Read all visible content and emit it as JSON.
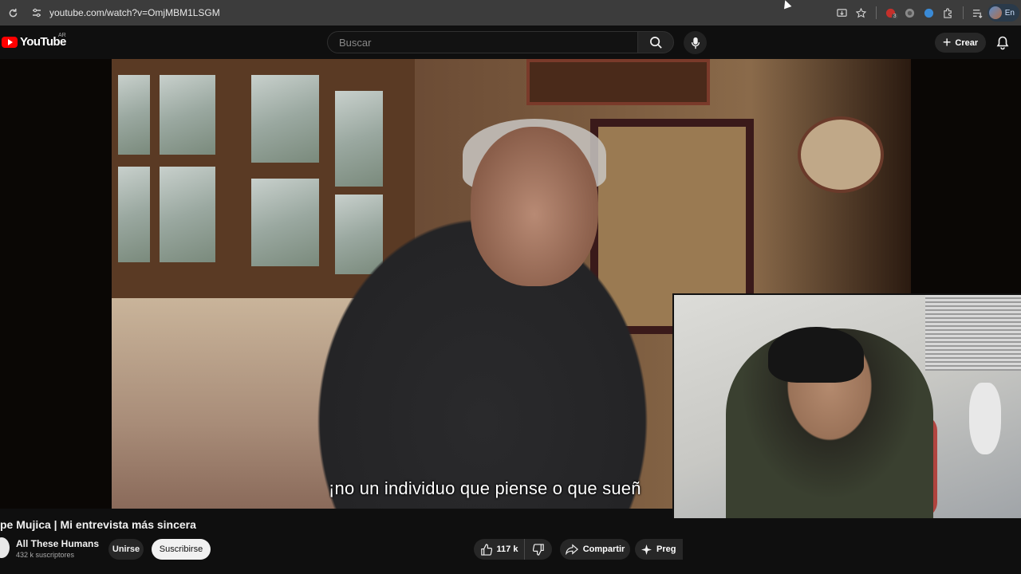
{
  "browser": {
    "url": "youtube.com/watch?v=OmjMBM1LSGM",
    "profile_label": "En",
    "extension_badge": "3"
  },
  "header": {
    "logo_text": "YouTube",
    "country_code": "AR",
    "search_placeholder": "Buscar",
    "create_label": "Crear"
  },
  "player": {
    "subtitle": "¡no un individuo que piense o que sueñ"
  },
  "video": {
    "title": "pe Mujica | Mi entrevista más sincera",
    "channel_name": "All These Humans",
    "subscribers": "432 k suscriptores",
    "join_label": "Unirse",
    "subscribe_label": "Suscribirse",
    "likes": "117 k",
    "share_label": "Compartir",
    "ask_label": "Preg"
  },
  "colors": {
    "brand": "#ff0000",
    "background": "#0f0f0f",
    "chip": "#272727"
  }
}
